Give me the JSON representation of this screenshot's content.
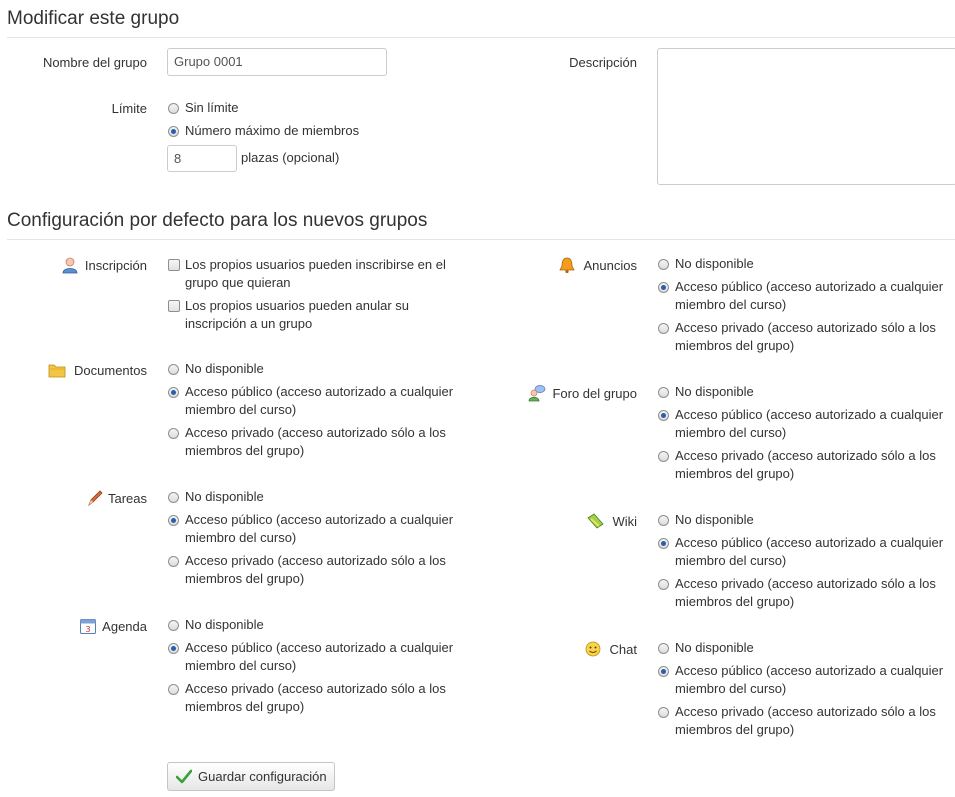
{
  "edit_section": {
    "title": "Modificar este grupo",
    "name_label": "Nombre del grupo",
    "name_value": "Grupo 0001",
    "description_label": "Descripción",
    "description_value": "",
    "limit_label": "Límite",
    "limit_options": [
      {
        "label": "Sin límite",
        "selected": false
      },
      {
        "label": "Número máximo de miembros",
        "selected": true
      }
    ],
    "max_members_value": "8",
    "max_members_suffix": "plazas (opcional)"
  },
  "defaults_section": {
    "title": "Configuración por defecto para los nuevos grupos",
    "inscription": {
      "label": "Inscripción",
      "icon": "user-icon",
      "options": [
        {
          "label_line1": "Los propios usuarios pueden inscribirse en el",
          "label_line2": "grupo que quieran",
          "checked": false
        },
        {
          "label_line1": "Los propios usuarios pueden anular su",
          "label_line2": "inscripción a un grupo",
          "checked": false
        }
      ]
    },
    "tools": {
      "documentos": {
        "label": "Documentos",
        "icon": "folder-icon"
      },
      "tareas": {
        "label": "Tareas",
        "icon": "pencil-icon"
      },
      "agenda": {
        "label": "Agenda",
        "icon": "calendar-icon"
      },
      "anuncios": {
        "label": "Anuncios",
        "icon": "bell-icon"
      },
      "foro": {
        "label": "Foro del grupo",
        "icon": "forum-icon"
      },
      "wiki": {
        "label": "Wiki",
        "icon": "wiki-icon"
      },
      "chat": {
        "label": "Chat",
        "icon": "chat-icon"
      }
    },
    "access_options": {
      "none": "No disponible",
      "public_1": "Acceso público (acceso autorizado a cualquier",
      "public_2": "miembro del curso)",
      "private_1": "Acceso privado (acceso autorizado sólo a los",
      "private_2": "miembros del grupo)"
    },
    "selected_option": "public"
  },
  "save_button": {
    "label": "Guardar configuración",
    "icon": "checkmark-icon"
  }
}
